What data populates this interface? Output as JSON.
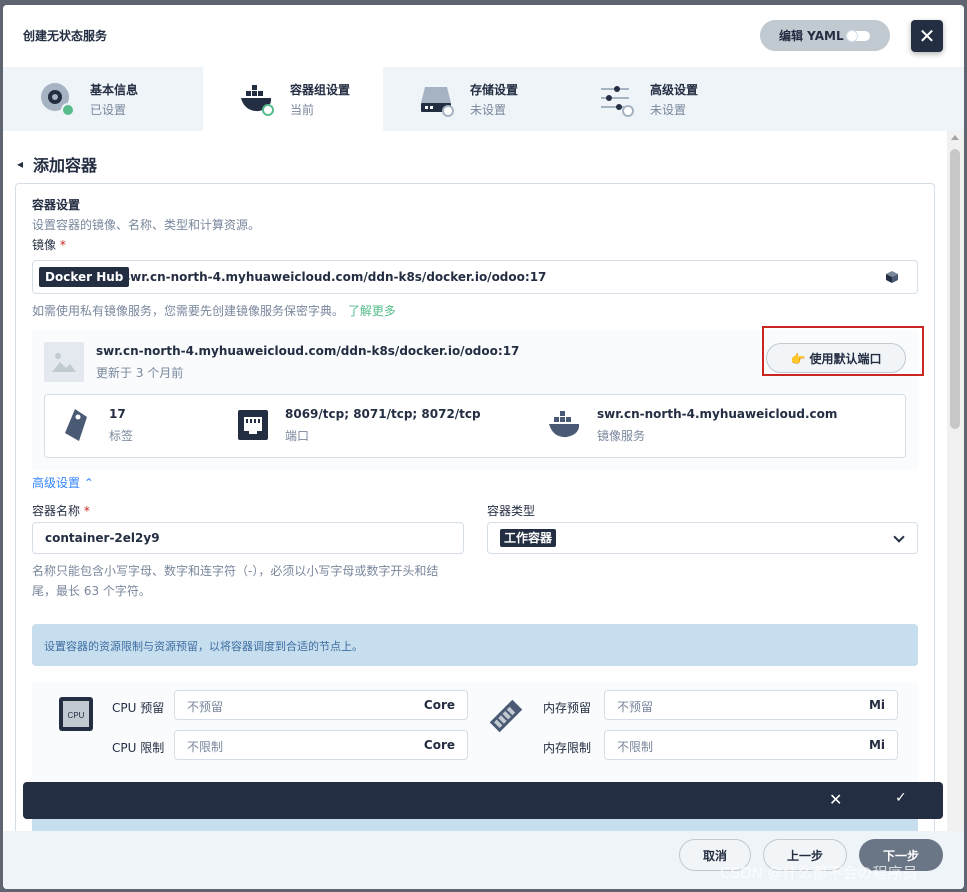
{
  "header": {
    "title": "创建无状态服务",
    "yaml_label": "编辑 YAML",
    "close_label": "✕"
  },
  "steps": [
    {
      "name": "基本信息",
      "status": "已设置"
    },
    {
      "name": "容器组设置",
      "status": "当前"
    },
    {
      "name": "存储设置",
      "status": "未设置"
    },
    {
      "name": "高级设置",
      "status": "未设置"
    }
  ],
  "page": {
    "back_arrow": "◂",
    "title": "添加容器"
  },
  "container_settings": {
    "section_title": "容器设置",
    "section_desc": "设置容器的镜像、名称、类型和计算资源。",
    "image_label": "镜像",
    "required_mark": "*",
    "registry_tag": "Docker Hub",
    "image_value": "swr.cn-north-4.myhuaweicloud.com/ddn-k8s/docker.io/odoo:17",
    "hint_text": "如需使用私有镜像服务，您需要先创建镜像服务保密字典。",
    "learn_more": "了解更多"
  },
  "image_card": {
    "name": "swr.cn-north-4.myhuaweicloud.com/ddn-k8s/docker.io/odoo:17",
    "updated": "更新于 3 个月前",
    "default_port_btn": "👉 使用默认端口",
    "tag_value": "17",
    "tag_label": "标签",
    "port_value": "8069/tcp; 8071/tcp; 8072/tcp",
    "port_label": "端口",
    "registry_value": "swr.cn-north-4.myhuaweicloud.com",
    "registry_label": "镜像服务"
  },
  "advanced": {
    "label": "高级设置 ⌃"
  },
  "name_field": {
    "label": "容器名称",
    "required_mark": "*",
    "value": "container-2el2y9",
    "hint_line1": "名称只能包含小写字母、数字和连字符（-），必须以小写字母或数字开头和结",
    "hint_line2": "尾，最长 63 个字符。"
  },
  "type_field": {
    "label": "容器类型",
    "value": "工作容器"
  },
  "notice": "设置容器的资源限制与资源预留，以将容器调度到合适的节点上。",
  "resources": {
    "cpu_icon_text": "CPU",
    "cpu_reserve_label": "CPU 预留",
    "cpu_reserve_placeholder": "不预留",
    "cpu_unit": "Core",
    "cpu_limit_label": "CPU 限制",
    "cpu_limit_placeholder": "不限制",
    "mem_reserve_label": "内存预留",
    "mem_reserve_placeholder": "不预留",
    "mem_unit": "Mi",
    "mem_limit_label": "内存限制",
    "mem_limit_placeholder": "不限制"
  },
  "toast": {
    "cancel": "✕",
    "confirm": "✓"
  },
  "footer": {
    "cancel": "取消",
    "prev": "上一步",
    "next": "下一步"
  },
  "watermark": "CSDN @什么都不会の程序员"
}
